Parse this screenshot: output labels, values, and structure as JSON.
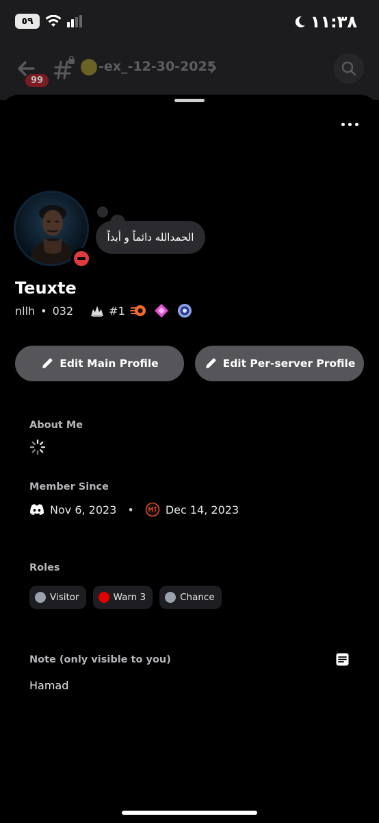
{
  "status_bar": {
    "battery": "٥٩",
    "time": "١١:٣٨"
  },
  "channel_header": {
    "unread_badge": "99",
    "channel_name": "-ex_-12-30-2025"
  },
  "profile": {
    "custom_status": "الحمدالله دائماً و أبداً",
    "display_name": "Teuxte",
    "username": "nllh",
    "separator": "•",
    "pronouns": "032",
    "clan_tag": "#1",
    "badges": [
      "nitro-boost-badge",
      "nitro-gem-badge",
      "hypesquad-badge"
    ]
  },
  "buttons": {
    "edit_main": "Edit Main Profile",
    "edit_server": "Edit Per-server Profile"
  },
  "about": {
    "label": "About Me"
  },
  "member_since": {
    "label": "Member Since",
    "discord_date": "Nov 6, 2023",
    "separator": "•",
    "server_date": "Dec 14, 2023"
  },
  "roles": {
    "label": "Roles",
    "items": [
      {
        "name": "Visitor",
        "color": "#9aa3ad"
      },
      {
        "name": "Warn 3",
        "color": "#e00000"
      },
      {
        "name": "Chance",
        "color": "#9aa3ad"
      }
    ]
  },
  "note": {
    "label": "Note (only visible to you)",
    "value": "Hamad"
  },
  "colors": {
    "accent_button": "#56565a",
    "dnd_status": "#e03a41"
  }
}
